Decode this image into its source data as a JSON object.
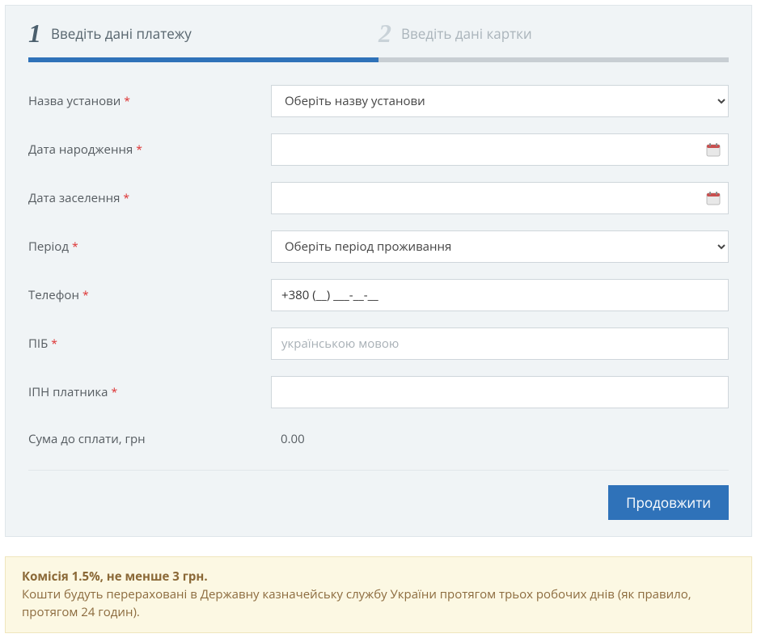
{
  "steps": {
    "s1": {
      "num": "1",
      "label": "Введіть дані платежу"
    },
    "s2": {
      "num": "2",
      "label": "Введіть дані картки"
    }
  },
  "form": {
    "institution": {
      "label": "Назва установи",
      "placeholder": "Оберіть назву установи"
    },
    "birth_date": {
      "label": "Дата народження"
    },
    "checkin": {
      "label": "Дата заселення"
    },
    "period": {
      "label": "Період",
      "placeholder": "Оберіть період проживання"
    },
    "phone": {
      "label": "Телефон",
      "value": "+380 (__) ___-__-__"
    },
    "fio": {
      "label": "ПІБ",
      "placeholder": "українською мовою"
    },
    "ipn": {
      "label": "ІПН платника"
    },
    "amount": {
      "label": "Сума до сплати, грн",
      "value": "0.00"
    }
  },
  "buttons": {
    "continue": "Продовжити"
  },
  "notice": {
    "title": "Комісія 1.5%, не менше 3 грн.",
    "body": "Кошти будуть перераховані в Державну казначейську службу України протягом трьох робочих днів (як правило, протягом 24 годин)."
  }
}
